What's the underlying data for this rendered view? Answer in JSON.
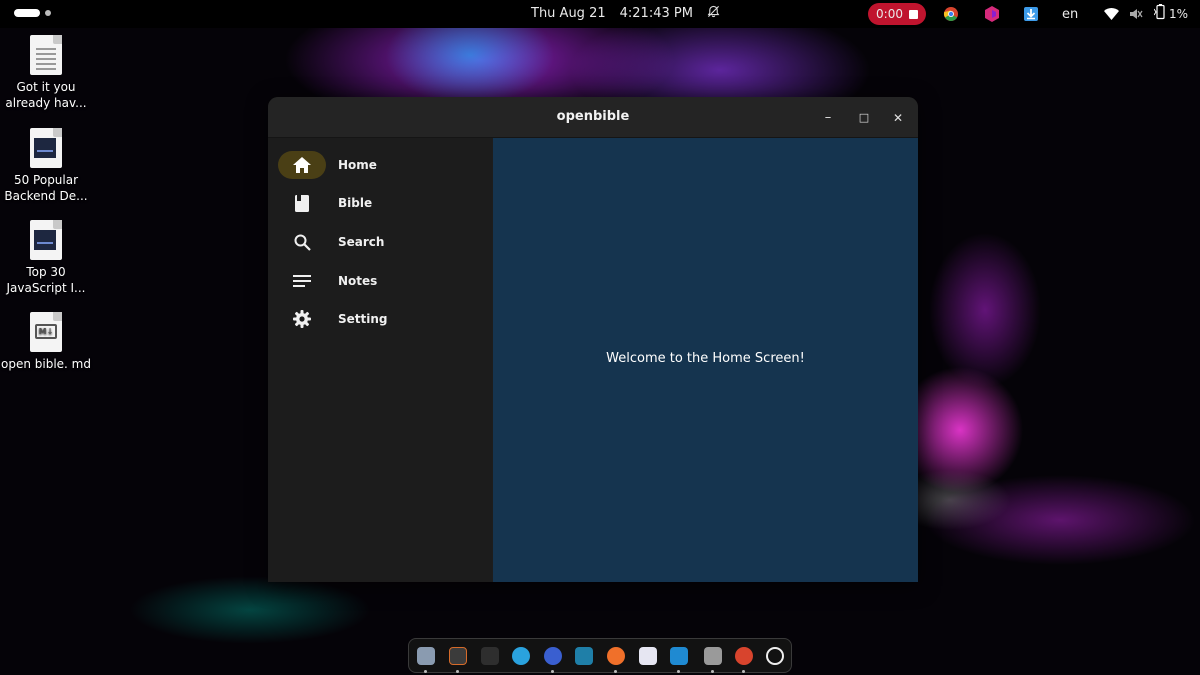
{
  "topbar": {
    "date": "Thu Aug 21",
    "time": "4:21:43 PM",
    "recording_time": "0:00",
    "language": "en",
    "battery": "1%",
    "icons": [
      "activities-icon",
      "notifications-muted-icon",
      "record-stop-icon",
      "chrome-icon",
      "app-icon",
      "download-icon",
      "wifi-icon",
      "volume-muted-icon",
      "battery-icon"
    ]
  },
  "desktop": {
    "items": [
      {
        "label": "Got it you already hav...",
        "icon": "text-file-icon"
      },
      {
        "label": "50 Popular Backend De...",
        "icon": "image-file-icon"
      },
      {
        "label": "Top 30 JavaScript I...",
        "icon": "image-file-icon"
      },
      {
        "label": "open bible. md",
        "icon": "markdown-file-icon"
      }
    ]
  },
  "window": {
    "title": "openbible",
    "controls": {
      "minimize": "–",
      "maximize": "□",
      "close": "✕"
    },
    "nav": [
      {
        "label": "Home",
        "icon": "home-icon",
        "active": true
      },
      {
        "label": "Bible",
        "icon": "book-icon",
        "active": false
      },
      {
        "label": "Search",
        "icon": "search-icon",
        "active": false
      },
      {
        "label": "Notes",
        "icon": "notes-icon",
        "active": false
      },
      {
        "label": "Setting",
        "icon": "gear-icon",
        "active": false
      }
    ],
    "content": {
      "message": "Welcome to the Home Screen!"
    }
  },
  "dock": {
    "apps": [
      "files-icon",
      "app-icon",
      "text-editor-icon",
      "telegram-icon",
      "app-icon",
      "app-icon",
      "firefox-icon",
      "app-icon",
      "vscode-icon",
      "settings-icon",
      "chrome-icon",
      "app-grid-icon"
    ]
  },
  "colors": {
    "accent_active": "#4a3f15",
    "content_bg": "#15344f",
    "sidebar_bg": "#1c1c1c",
    "record": "#c0142e"
  }
}
